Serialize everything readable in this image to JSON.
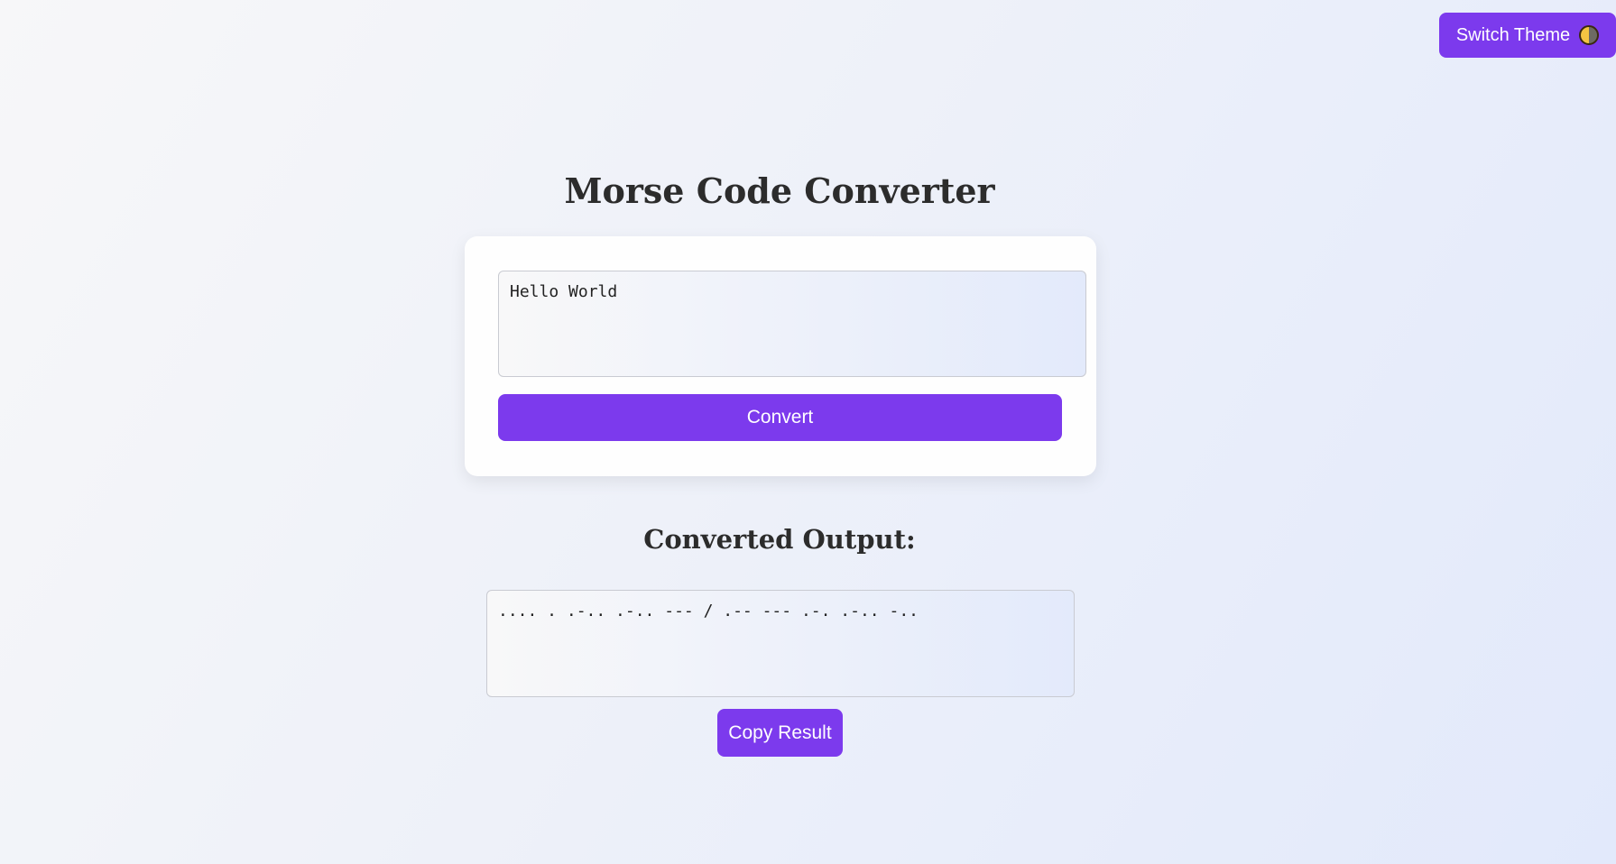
{
  "header": {
    "theme_button_label": "Switch Theme",
    "theme_icon": "half-moon-icon"
  },
  "main": {
    "title": "Morse Code Converter",
    "input": {
      "value": "Hello World",
      "placeholder": ""
    },
    "convert_label": "Convert",
    "output_heading": "Converted Output:",
    "output": {
      "value": ".... . .-.. .-.. --- / .-- --- .-. .-.. -.."
    },
    "copy_label": "Copy Result"
  },
  "colors": {
    "accent": "#7c3aed",
    "title_text": "#2c2c2c",
    "card_bg": "#fefefe"
  }
}
